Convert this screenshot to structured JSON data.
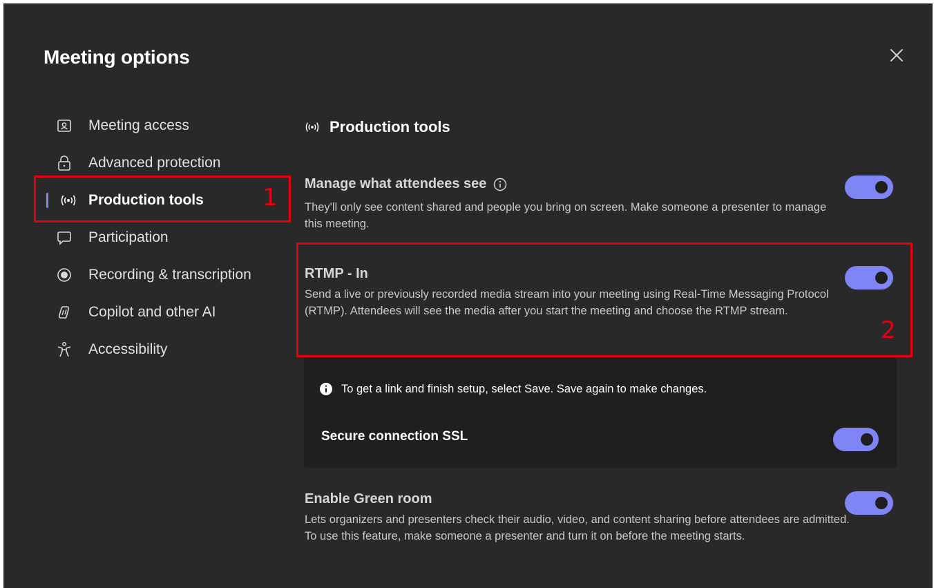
{
  "dialog": {
    "title": "Meeting options",
    "close_icon": "close-icon"
  },
  "sidebar": {
    "items": [
      {
        "label": "Meeting access",
        "icon": "person-card-icon"
      },
      {
        "label": "Advanced protection",
        "icon": "lock-icon"
      },
      {
        "label": "Production tools",
        "icon": "broadcast-icon",
        "active": true
      },
      {
        "label": "Participation",
        "icon": "chat-bubble-icon"
      },
      {
        "label": "Recording & transcription",
        "icon": "record-icon"
      },
      {
        "label": "Copilot and other AI",
        "icon": "copilot-icon"
      },
      {
        "label": "Accessibility",
        "icon": "accessibility-icon"
      }
    ]
  },
  "annotations": {
    "box1_label": "1",
    "box2_label": "2"
  },
  "content": {
    "section_title": "Production tools",
    "manage_attendees": {
      "title": "Manage what attendees see",
      "description": "They'll only see content shared and people you bring on screen. Make someone a presenter to manage this meeting.",
      "enabled": true
    },
    "rtmp_in": {
      "title": "RTMP - In",
      "description": "Send a live or previously recorded media stream into your meeting using Real-Time Messaging Protocol (RTMP). Attendees will see the media after you start the meeting and choose the RTMP stream.",
      "enabled": true
    },
    "rtmp_panel": {
      "info_text": "To get a link and finish setup, select Save. Save again to make changes.",
      "ssl_label": "Secure connection SSL",
      "ssl_enabled": true
    },
    "green_room": {
      "title": "Enable Green room",
      "description": "Lets organizers and presenters check their audio, video, and content sharing before attendees are admitted. To use this feature, make someone a presenter and turn it on before the meeting starts.",
      "enabled": true
    }
  },
  "colors": {
    "background": "#292929",
    "panel": "#1f1f1f",
    "accent": "#7f85f5",
    "annotation": "#e60012"
  }
}
